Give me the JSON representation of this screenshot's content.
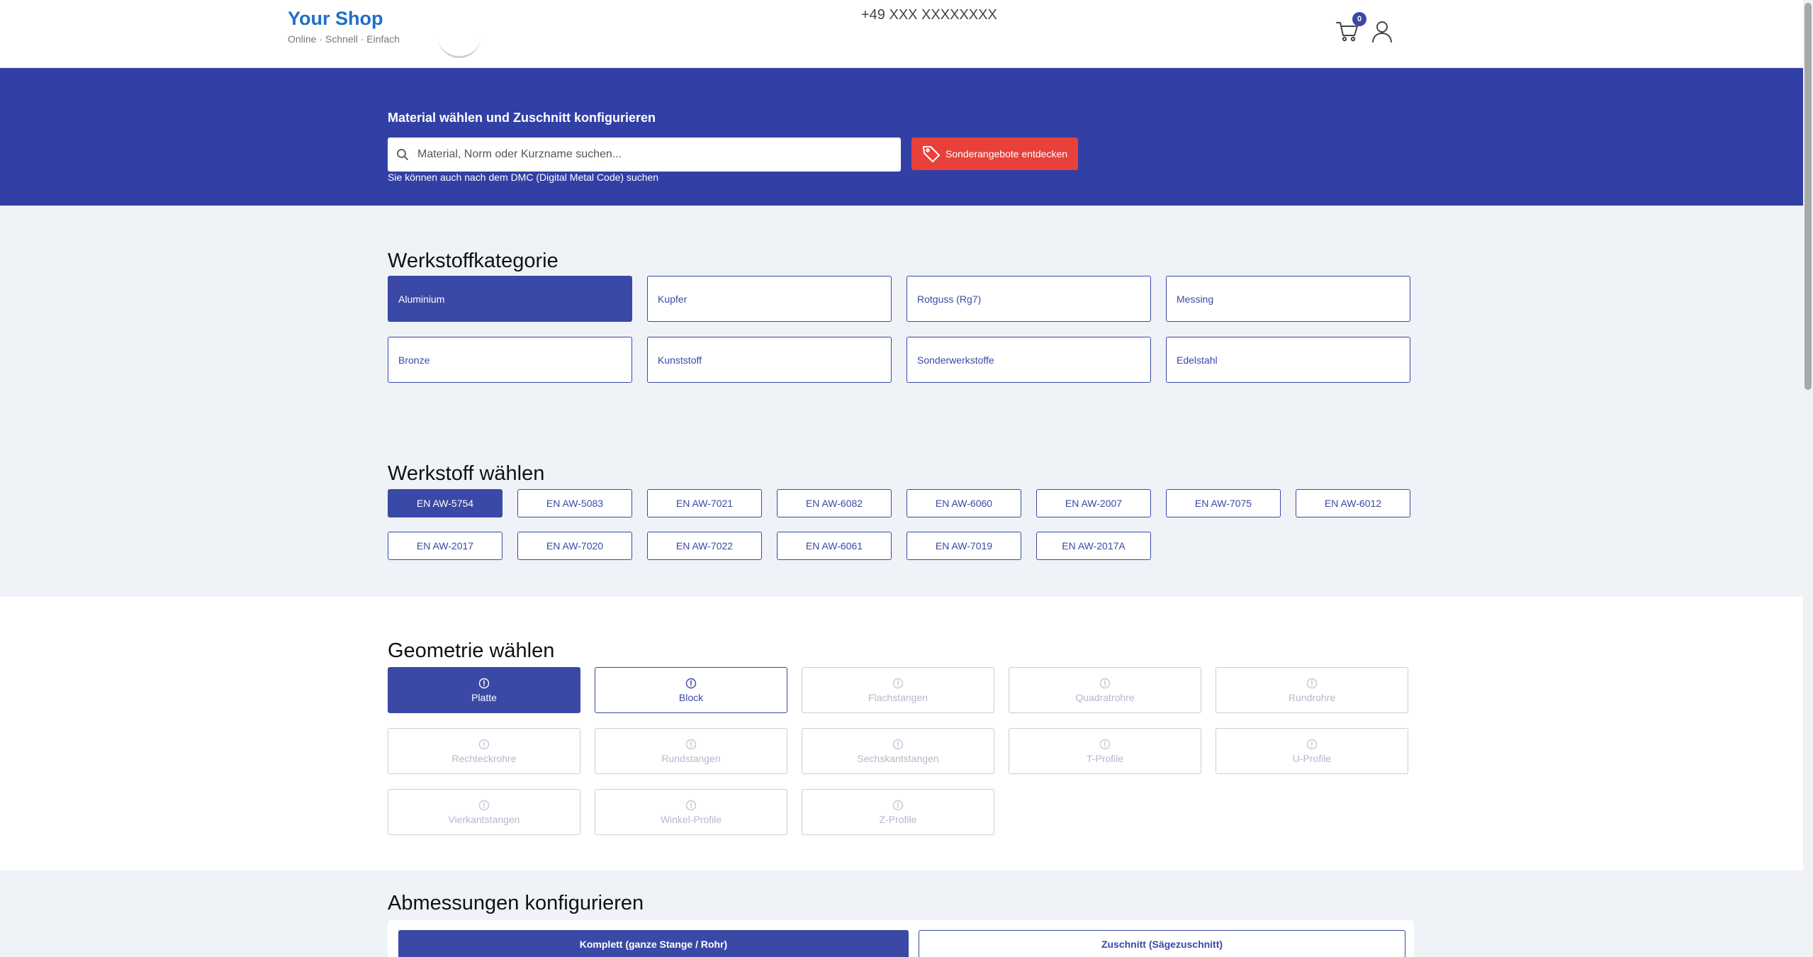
{
  "header": {
    "brand_name": "Your Shop",
    "brand_tagline": "Online · Schnell · Einfach",
    "phone": "+49 XXX XXXXXXXX",
    "cart_count": "0"
  },
  "hero": {
    "title": "Material wählen und Zuschnitt konfigurieren",
    "search_placeholder": "Material, Norm oder Kurzname suchen...",
    "deals_label": "Sonderangebote entdecken",
    "hint": "Sie können auch nach dem DMC (Digital Metal Code) suchen"
  },
  "categories": {
    "title": "Werkstoffkategorie",
    "items": [
      {
        "label": "Aluminium",
        "state": "active"
      },
      {
        "label": "Kupfer",
        "state": "enabled"
      },
      {
        "label": "Rotguss (Rg7)",
        "state": "enabled"
      },
      {
        "label": "Messing",
        "state": "enabled"
      },
      {
        "label": "Bronze",
        "state": "enabled"
      },
      {
        "label": "Kunststoff",
        "state": "enabled"
      },
      {
        "label": "Sonderwerkstoffe",
        "state": "enabled"
      },
      {
        "label": "Edelstahl",
        "state": "enabled"
      }
    ]
  },
  "materials": {
    "title": "Werkstoff wählen",
    "items": [
      {
        "label": "EN AW-5754",
        "state": "active"
      },
      {
        "label": "EN AW-5083",
        "state": "enabled"
      },
      {
        "label": "EN AW-7021",
        "state": "enabled"
      },
      {
        "label": "EN AW-6082",
        "state": "enabled"
      },
      {
        "label": "EN AW-6060",
        "state": "enabled"
      },
      {
        "label": "EN AW-2007",
        "state": "enabled"
      },
      {
        "label": "EN AW-7075",
        "state": "enabled"
      },
      {
        "label": "EN AW-6012",
        "state": "enabled"
      },
      {
        "label": "EN AW-2017",
        "state": "enabled"
      },
      {
        "label": "EN AW-7020",
        "state": "enabled"
      },
      {
        "label": "EN AW-7022",
        "state": "enabled"
      },
      {
        "label": "EN AW-6061",
        "state": "enabled"
      },
      {
        "label": "EN AW-7019",
        "state": "enabled"
      },
      {
        "label": "EN AW-2017A",
        "state": "enabled"
      }
    ]
  },
  "geometry": {
    "title": "Geometrie wählen",
    "icon": "info-circle-icon",
    "items": [
      {
        "label": "Platte",
        "state": "active"
      },
      {
        "label": "Block",
        "state": "enabled"
      },
      {
        "label": "Flachstangen",
        "state": "disabled"
      },
      {
        "label": "Quadratrohre",
        "state": "disabled"
      },
      {
        "label": "Rundrohre",
        "state": "disabled"
      },
      {
        "label": "Rechteckrohre",
        "state": "disabled"
      },
      {
        "label": "Rundstangen",
        "state": "disabled"
      },
      {
        "label": "Sechskantstangen",
        "state": "disabled"
      },
      {
        "label": "T-Profile",
        "state": "disabled"
      },
      {
        "label": "U-Profile",
        "state": "disabled"
      },
      {
        "label": "Vierkantstangen",
        "state": "disabled"
      },
      {
        "label": "Winkel-Profile",
        "state": "disabled"
      },
      {
        "label": "Z-Profile",
        "state": "disabled"
      }
    ]
  },
  "dimensions": {
    "title": "Abmessungen konfigurieren",
    "tab_full": "Komplett (ganze Stange / Rohr)",
    "tab_cut": "Zuschnitt (Sägezuschnitt)"
  },
  "colors": {
    "primary": "#3a49a5",
    "hero_bg": "#3240a5",
    "accent_red": "#e8403a",
    "brand_blue": "#1e6fc9"
  }
}
